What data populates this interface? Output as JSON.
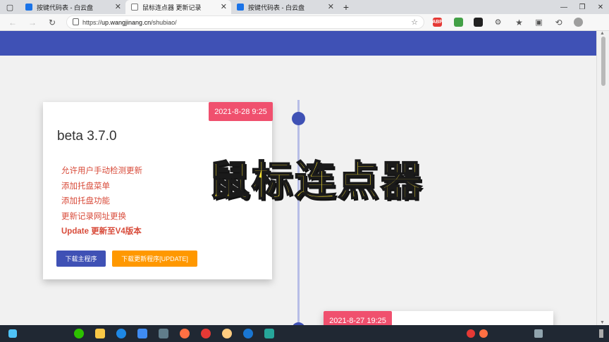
{
  "browser": {
    "tabs": [
      {
        "label": "按键代码表 - 白云盘",
        "active": false
      },
      {
        "label": "鼠标连点器 更新记录",
        "active": true
      },
      {
        "label": "按键代码表 - 白云盘",
        "active": false
      }
    ],
    "new_tab_symbol": "+",
    "url": {
      "scheme": "https://",
      "host": "up.wangjinang.cn",
      "path": "/shubiao/"
    },
    "extensions": [
      "ABP"
    ]
  },
  "timeline": {
    "entries": [
      {
        "date": "2021-8-28 9:25",
        "version": "beta 3.7.0",
        "changes": [
          {
            "text": "允许用户手动检测更新",
            "strong": false
          },
          {
            "text": "添加托盘菜单",
            "strong": false
          },
          {
            "text": "添加托盘功能",
            "strong": false
          },
          {
            "text": "更新记录网址更换",
            "strong": false
          },
          {
            "text": "Update 更新至V4版本",
            "strong": true
          }
        ],
        "buttons": {
          "download_main": "下载主程序",
          "download_update": "下载更新程序[UPDATE]"
        }
      },
      {
        "date": "2021-8-27 19:25"
      }
    ]
  },
  "overlay_title": "鼠标连点器",
  "colors": {
    "accent": "#3f51b5",
    "badge": "#f0506e",
    "change_text": "#d84b3a",
    "update_button": "#ff9800",
    "overlay": "#fde534"
  }
}
